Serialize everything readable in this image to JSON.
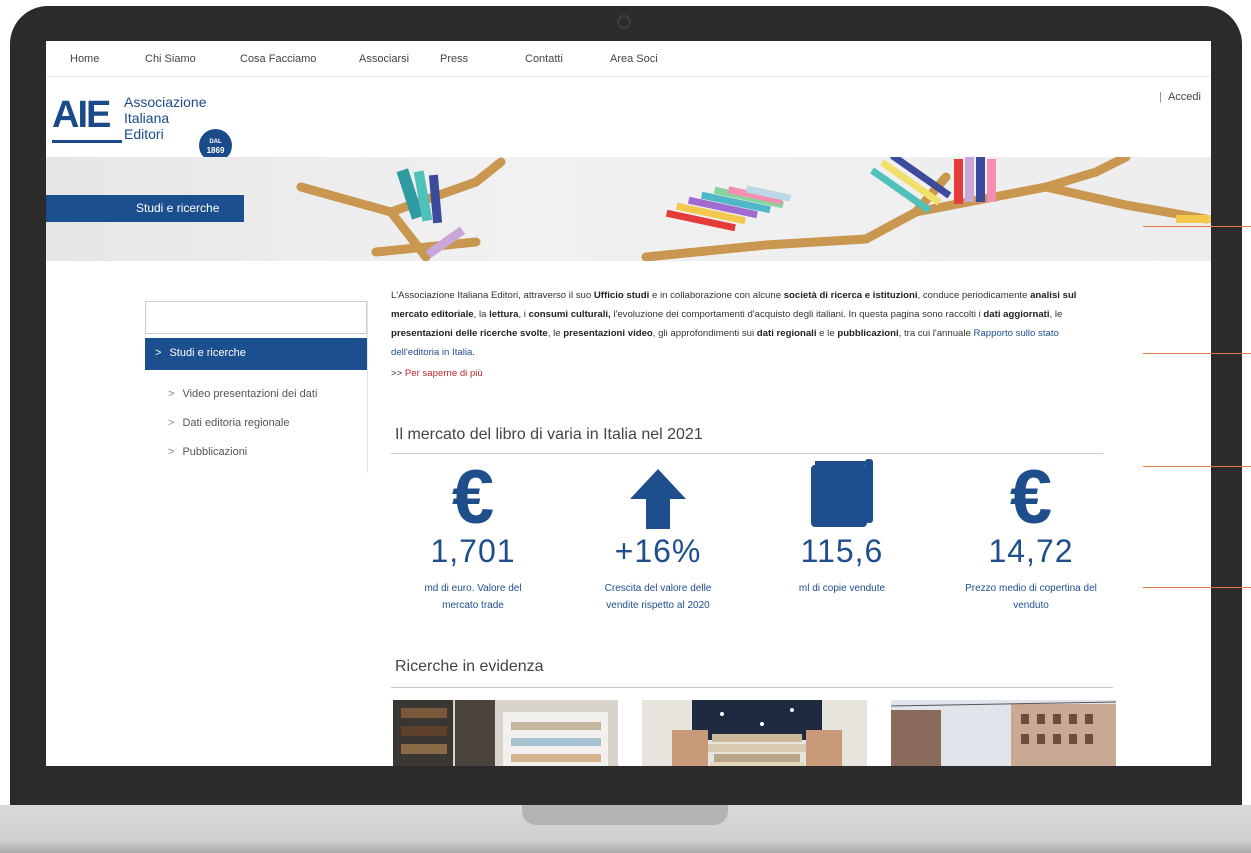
{
  "nav": {
    "items": [
      "Home",
      "Chi Siamo",
      "Cosa Facciamo",
      "Associarsi",
      "Press",
      "Contatti",
      "Area Soci"
    ]
  },
  "logo": {
    "mark": "AIE",
    "line1": "Associazione",
    "line2": "Italiana",
    "line3": "Editori",
    "badge_small": "DAL",
    "badge_year": "1869"
  },
  "login": {
    "separator": "|",
    "label": "Accedi"
  },
  "hero": {
    "label": "Studi e ricerche"
  },
  "sidebar": {
    "search_placeholder": "",
    "active": {
      "chevron": ">",
      "label": "Studi e ricerche"
    },
    "items": [
      {
        "chevron": ">",
        "label": "Video presentazioni dei dati"
      },
      {
        "chevron": ">",
        "label": "Dati editoria regionale"
      },
      {
        "chevron": ">",
        "label": "Pubblicazioni"
      }
    ]
  },
  "intro": {
    "p1": "L'Associazione Italiana Editori, attraverso il suo ",
    "b1": "Ufficio studi",
    "p2": " e in collaborazione con alcune ",
    "b2": "società di ricerca e istituzioni",
    "p3": ", conduce periodicamente ",
    "b3": "analisi sul mercato editoriale",
    "p4": ", la ",
    "b4": "lettura",
    "p5": ", i ",
    "b5": "consumi culturali,",
    "p6": " l'evoluzione dei comportamenti d'acquisto degli italiani. In questa pagina sono raccolti i ",
    "b6": "dati aggiornati",
    "p7": ", le ",
    "b7": "presentazioni delle ricerche svolte",
    "p8": ", le ",
    "b8": "presentazioni video",
    "p9": ", gli approfondimenti sui ",
    "b9": "dati regionali",
    "p10": " e le ",
    "b10": "pubblicazioni",
    "p11": ", tra cui l'annuale ",
    "link": "Rapporto sullo stato dell'editoria in Italia",
    "p12": "."
  },
  "more": {
    "prefix": ">>",
    "label": "Per saperne di più"
  },
  "market": {
    "title": "Il mercato del libro di varia in Italia nel 2021",
    "stats": [
      {
        "icon": "euro-icon",
        "value": "1,701",
        "desc1": "md di euro. Valore del",
        "desc2": "mercato trade"
      },
      {
        "icon": "arrow-up-icon",
        "value": "+16%",
        "desc1": "Crescita del valore delle",
        "desc2": "vendite rispetto al 2020"
      },
      {
        "icon": "book-icon",
        "value": "115,6",
        "desc1": "ml di copie vendute",
        "desc2": ""
      },
      {
        "icon": "euro-icon",
        "value": "14,72",
        "desc1": "Prezzo medio di copertina del",
        "desc2": "venduto"
      }
    ]
  },
  "featured": {
    "title": "Ricerche in evidenza"
  },
  "colors": {
    "brand_blue": "#1c4f8f",
    "accent_red": "#c0272d",
    "orange_line": "#e07a4a",
    "bezel": "#2b2b2b"
  }
}
